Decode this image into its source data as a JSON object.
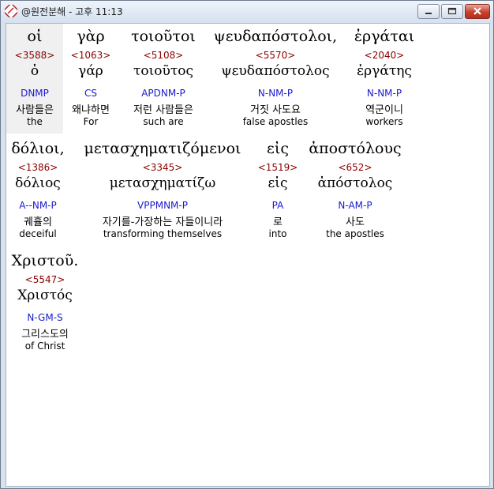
{
  "window": {
    "title": "@원전분해 - 고후 11:13"
  },
  "rows": [
    [
      {
        "g": "οἱ",
        "num": "<3588>",
        "lem": "ὁ",
        "par": "DNMP",
        "ko": "사람들은",
        "en": "the"
      },
      {
        "g": "γὰρ",
        "num": "<1063>",
        "lem": "γάρ",
        "par": "CS",
        "ko": "왜냐하면",
        "en": "For"
      },
      {
        "g": "τοιοῦτοι",
        "num": "<5108>",
        "lem": "τοιοῦτος",
        "par": "APDNM-P",
        "ko": "저런 사람들은",
        "en": "such are"
      },
      {
        "g": "ψευδαπόστολοι,",
        "num": "<5570>",
        "lem": "ψευδαπόστολος",
        "par": "N-NM-P",
        "ko": "거짓 사도요",
        "en": "false apostles"
      },
      {
        "g": "ἐργάται",
        "num": "<2040>",
        "lem": "ἐργάτης",
        "par": "N-NM-P",
        "ko": "역군이니",
        "en": "workers"
      }
    ],
    [
      {
        "g": "δόλιοι,",
        "num": "<1386>",
        "lem": "δόλιος",
        "par": "A--NM-P",
        "ko": "궤휼의",
        "en": "deceiful"
      },
      {
        "g": "μετασχηματιζόμενοι",
        "num": "<3345>",
        "lem": "μετασχηματίζω",
        "par": "VPPMNM-P",
        "ko": "자기를-가장하는 자들이니라",
        "en": "transforming themselves"
      },
      {
        "g": "εἰς",
        "num": "<1519>",
        "lem": "εἰς",
        "par": "PA",
        "ko": "로",
        "en": "into"
      },
      {
        "g": "ἀποστόλους",
        "num": "<652>",
        "lem": "ἀπόστολος",
        "par": "N-AM-P",
        "ko": "사도",
        "en": "the apostles"
      }
    ],
    [
      {
        "g": "Χριστοῦ.",
        "num": "<5547>",
        "lem": "Χριστός",
        "par": "N-GM-S",
        "ko": "그리스도의",
        "en": "of Christ"
      }
    ]
  ]
}
